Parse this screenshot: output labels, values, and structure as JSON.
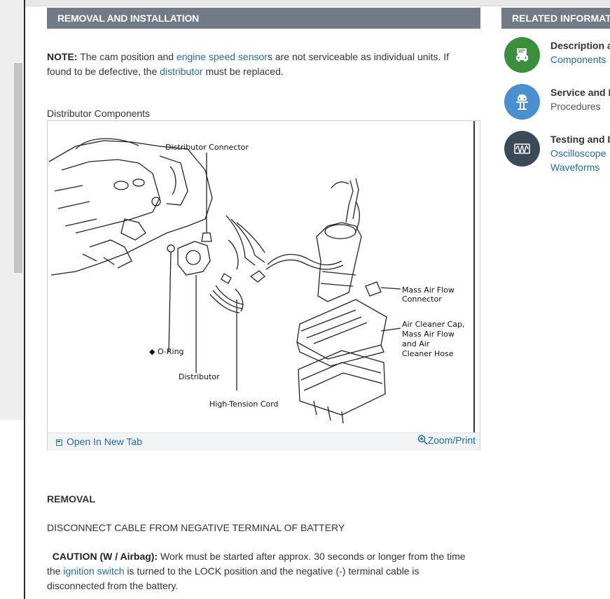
{
  "section": {
    "title": "REMOVAL AND INSTALLATION"
  },
  "note": {
    "label": "NOTE:",
    "part1": "The cam position and",
    "link1": "engine speed sensor",
    "part2": "s are not serviceable as individual units. If found to be defective, the",
    "link2": "distributor",
    "part3": "must be replaced."
  },
  "figure": {
    "caption": "Distributor Components",
    "labels": {
      "distributor_connector": "Distributor Connector",
      "o_ring": "◆ O-Ring",
      "distributor": "Distributor",
      "high_tension_cord": "High-Tension Cord",
      "maf_connector_1": "Mass Air Flow",
      "maf_connector_2": "Connector",
      "air_cleaner_1": "Air Cleaner Cap,",
      "air_cleaner_2": "Mass Air Flow",
      "air_cleaner_3": "and Air",
      "air_cleaner_4": "Cleaner Hose"
    },
    "open_new_tab": "Open In New Tab",
    "zoom_print": "Zoom/Print"
  },
  "removal": {
    "title": "REMOVAL",
    "step1": "DISCONNECT CABLE FROM NEGATIVE TERMINAL OF BATTERY",
    "caution_label": "CAUTION (W / Airbag):",
    "caution_part1": "Work must be started after approx. 30 seconds or longer from the time the",
    "caution_link": "ignition switch",
    "caution_part2": "is turned to the LOCK position and the negative (-) terminal cable is disconnected from the battery."
  },
  "related": {
    "title": "RELATED INFORMATIO",
    "items": [
      {
        "title": "Description ar",
        "sub": "Components",
        "icon": "car-info-icon",
        "color": "#3b8f3b"
      },
      {
        "title": "Service and R",
        "sub": "Procedures",
        "icon": "car-lift-icon",
        "color": "#4a90d0"
      },
      {
        "title": "Testing and In",
        "sub": "Oscilloscope",
        "sub2": "Waveforms",
        "icon": "waveform-icon",
        "color": "#3c4a57"
      }
    ]
  }
}
